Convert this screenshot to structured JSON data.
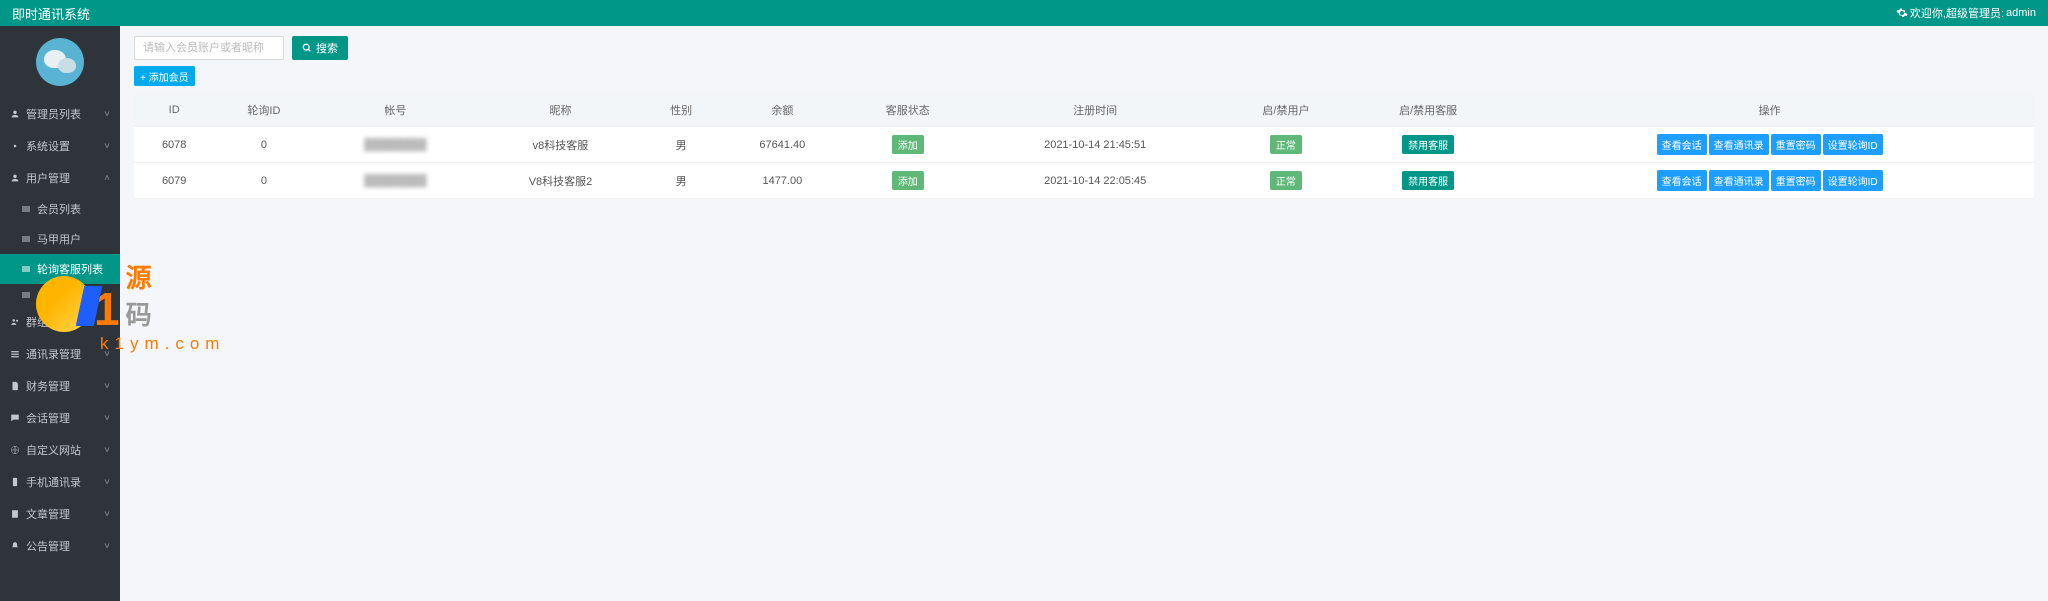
{
  "header": {
    "title": "即时通讯系统",
    "welcome_prefix": "欢迎你,超级管理员:",
    "welcome_user": "admin"
  },
  "sidebar": {
    "groups": [
      {
        "type": "item",
        "icon": "user",
        "label": "管理员列表",
        "expanded": false
      },
      {
        "type": "item",
        "icon": "cog",
        "label": "系统设置",
        "expanded": false
      },
      {
        "type": "item",
        "icon": "user",
        "label": "用户管理",
        "expanded": true,
        "children": [
          {
            "label": "会员列表",
            "active": false
          },
          {
            "label": "马甲用户",
            "active": false
          },
          {
            "label": "轮询客服列表",
            "active": true
          },
          {
            "label": "",
            "active": false
          }
        ]
      },
      {
        "type": "item",
        "icon": "users",
        "label": "群组",
        "expanded": false
      },
      {
        "type": "item",
        "icon": "list",
        "label": "通讯录管理",
        "expanded": false
      },
      {
        "type": "item",
        "icon": "file",
        "label": "财务管理",
        "expanded": false
      },
      {
        "type": "item",
        "icon": "comment",
        "label": "会话管理",
        "expanded": false
      },
      {
        "type": "item",
        "icon": "globe",
        "label": "自定义网站",
        "expanded": false
      },
      {
        "type": "item",
        "icon": "mobile",
        "label": "手机通讯录",
        "expanded": false
      },
      {
        "type": "item",
        "icon": "book",
        "label": "文章管理",
        "expanded": false
      },
      {
        "type": "item",
        "icon": "bell",
        "label": "公告管理",
        "expanded": false
      }
    ]
  },
  "toolbar": {
    "search_placeholder": "请输入会员账户或者昵称",
    "search_label": "搜索",
    "add_label": "+ 添加会员"
  },
  "table": {
    "headers": [
      "ID",
      "轮询ID",
      "帐号",
      "昵称",
      "性别",
      "余额",
      "客服状态",
      "注册时间",
      "启/禁用户",
      "启/禁用客服",
      "操作"
    ],
    "rows": [
      {
        "id": "6078",
        "poll_id": "0",
        "account": "████████",
        "nickname": "v8科技客服",
        "gender": "男",
        "balance": "67641.40",
        "cs_status": "添加",
        "reg_time": "2021-10-14 21:45:51",
        "user_toggle": "正常",
        "cs_toggle": "禁用客服",
        "actions": [
          "查看会话",
          "查看通讯录",
          "重置密码",
          "设置轮询ID"
        ]
      },
      {
        "id": "6079",
        "poll_id": "0",
        "account": "████████",
        "nickname": "V8科技客服2",
        "gender": "男",
        "balance": "1477.00",
        "cs_status": "添加",
        "reg_time": "2021-10-14 22:05:45",
        "user_toggle": "正常",
        "cs_toggle": "禁用客服",
        "actions": [
          "查看会话",
          "查看通讯录",
          "重置密码",
          "设置轮询ID"
        ]
      }
    ]
  },
  "watermark": {
    "brand_num": "1",
    "brand_txt1": "源",
    "brand_txt2": "码",
    "url": "k1ym.com"
  }
}
